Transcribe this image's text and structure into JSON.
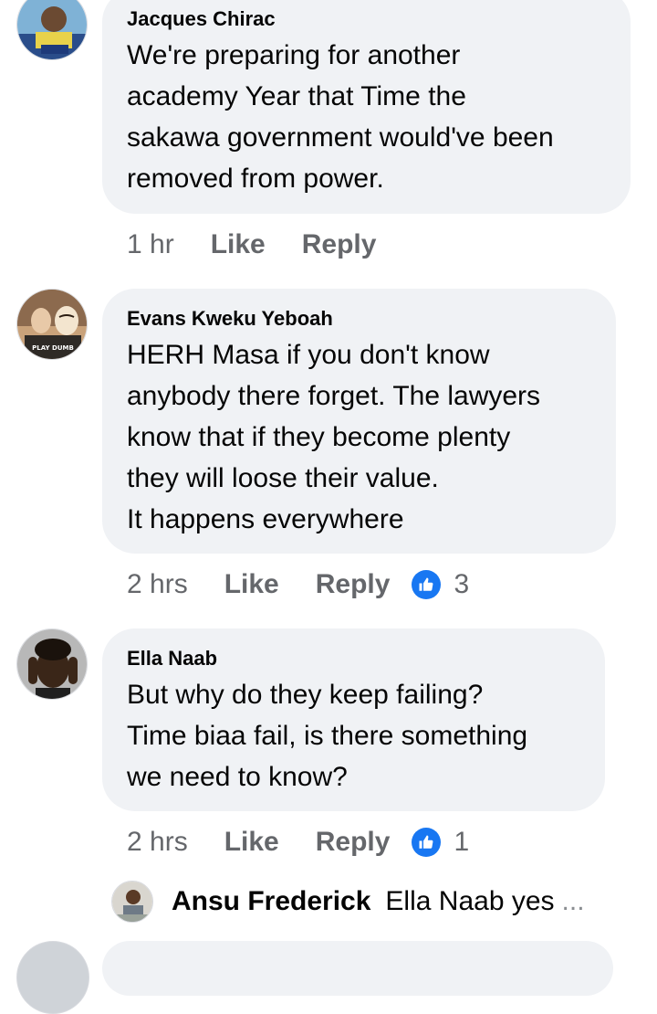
{
  "comments": [
    {
      "author": "Jacques Chirac",
      "lines": [
        "We're preparing for another",
        "academy Year that Time the",
        "sakawa government would've been",
        "removed from power."
      ],
      "time": "1 hr",
      "like_label": "Like",
      "reply_label": "Reply",
      "reaction_count": ""
    },
    {
      "author": "Evans Kweku Yeboah",
      "lines": [
        "HERH Masa if you don't know",
        "anybody there forget. The lawyers",
        "know that if they become plenty",
        "they will loose their value.",
        "It happens everywhere"
      ],
      "time": "2 hrs",
      "like_label": "Like",
      "reply_label": "Reply",
      "reaction_count": "3",
      "avatar_caption": "PLAY DUMB"
    },
    {
      "author": "Ella Naab",
      "lines": [
        "But why do they keep failing?",
        "Time biaa fail, is there something",
        "we need to know?"
      ],
      "time": "2 hrs",
      "like_label": "Like",
      "reply_label": "Reply",
      "reaction_count": "1"
    }
  ],
  "reply_preview": {
    "author": "Ansu Frederick",
    "text": "Ella Naab yes",
    "ellipsis": "..."
  },
  "colors": {
    "bubble": "#f0f2f5",
    "meta_text": "#65676b",
    "like_blue": "#1877f2"
  },
  "icons": {
    "reaction": "thumbs-up-icon"
  }
}
